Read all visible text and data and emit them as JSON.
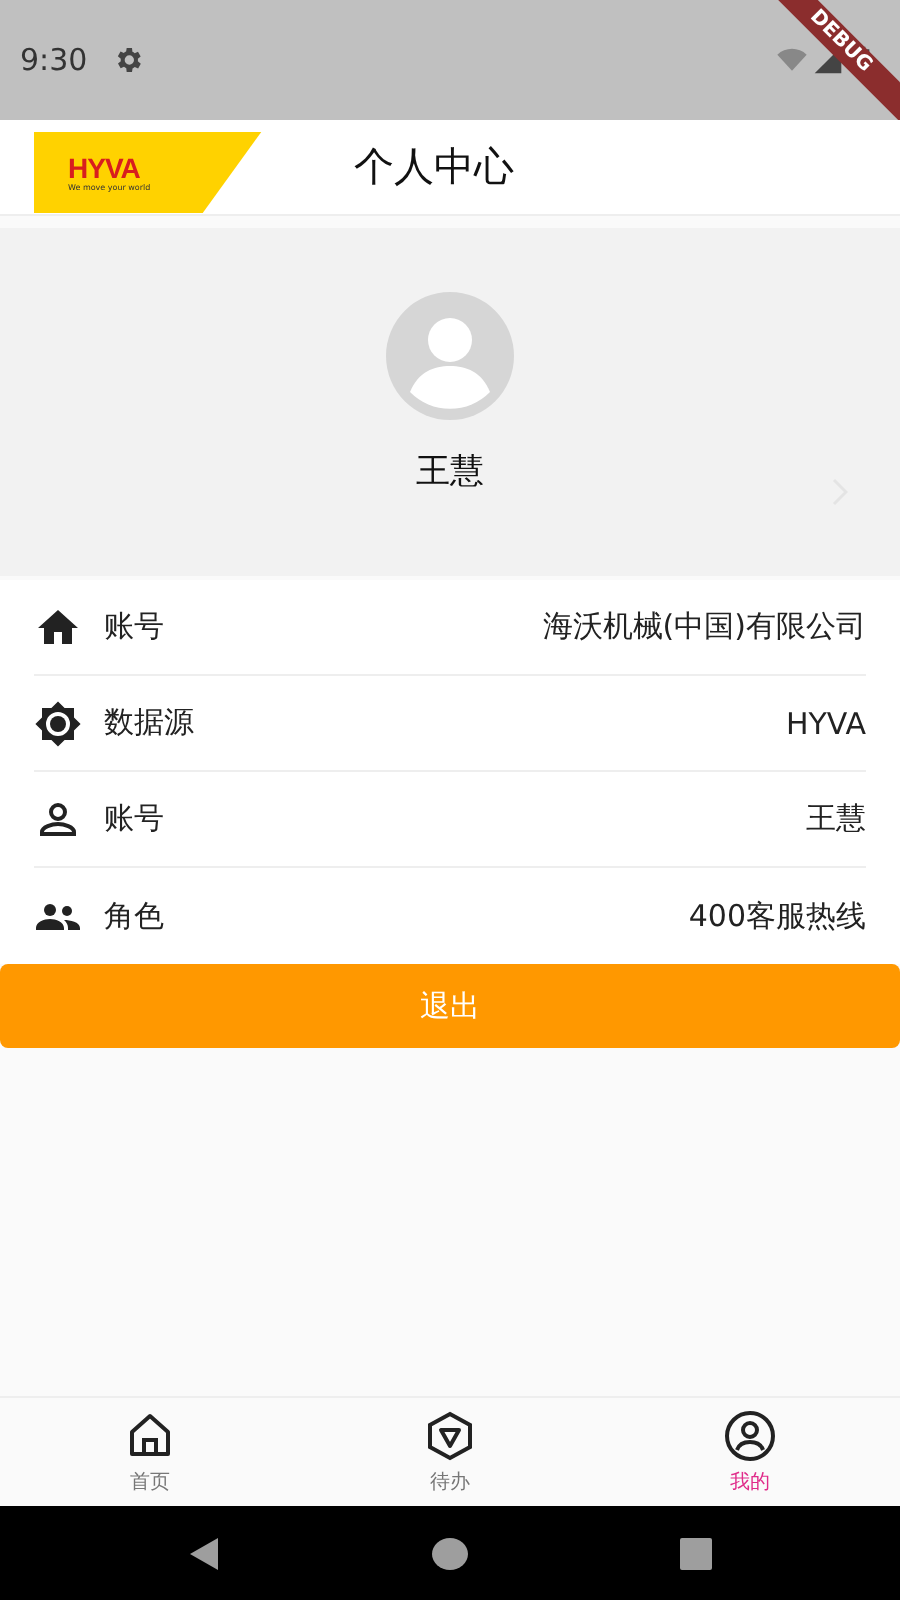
{
  "status_bar": {
    "time": "9:30",
    "debug_banner": "DEBUG"
  },
  "app_bar": {
    "logo": {
      "brand": "HYVA",
      "tagline": "We move your world"
    },
    "title": "个人中心"
  },
  "profile": {
    "name": "王慧"
  },
  "info_rows": [
    {
      "kind": "home",
      "label": "账号",
      "value": "海沃机械(中国)有限公司"
    },
    {
      "kind": "brightness",
      "label": "数据源",
      "value": "HYVA"
    },
    {
      "kind": "person",
      "label": "账号",
      "value": "王慧"
    },
    {
      "kind": "group",
      "label": "角色",
      "value": "400客服热线"
    }
  ],
  "logout_button": "退出",
  "bottom_nav": [
    {
      "kind": "home",
      "label": "首页",
      "selected": false
    },
    {
      "kind": "todo",
      "label": "待办",
      "selected": false
    },
    {
      "kind": "profile",
      "label": "我的",
      "selected": true
    }
  ]
}
